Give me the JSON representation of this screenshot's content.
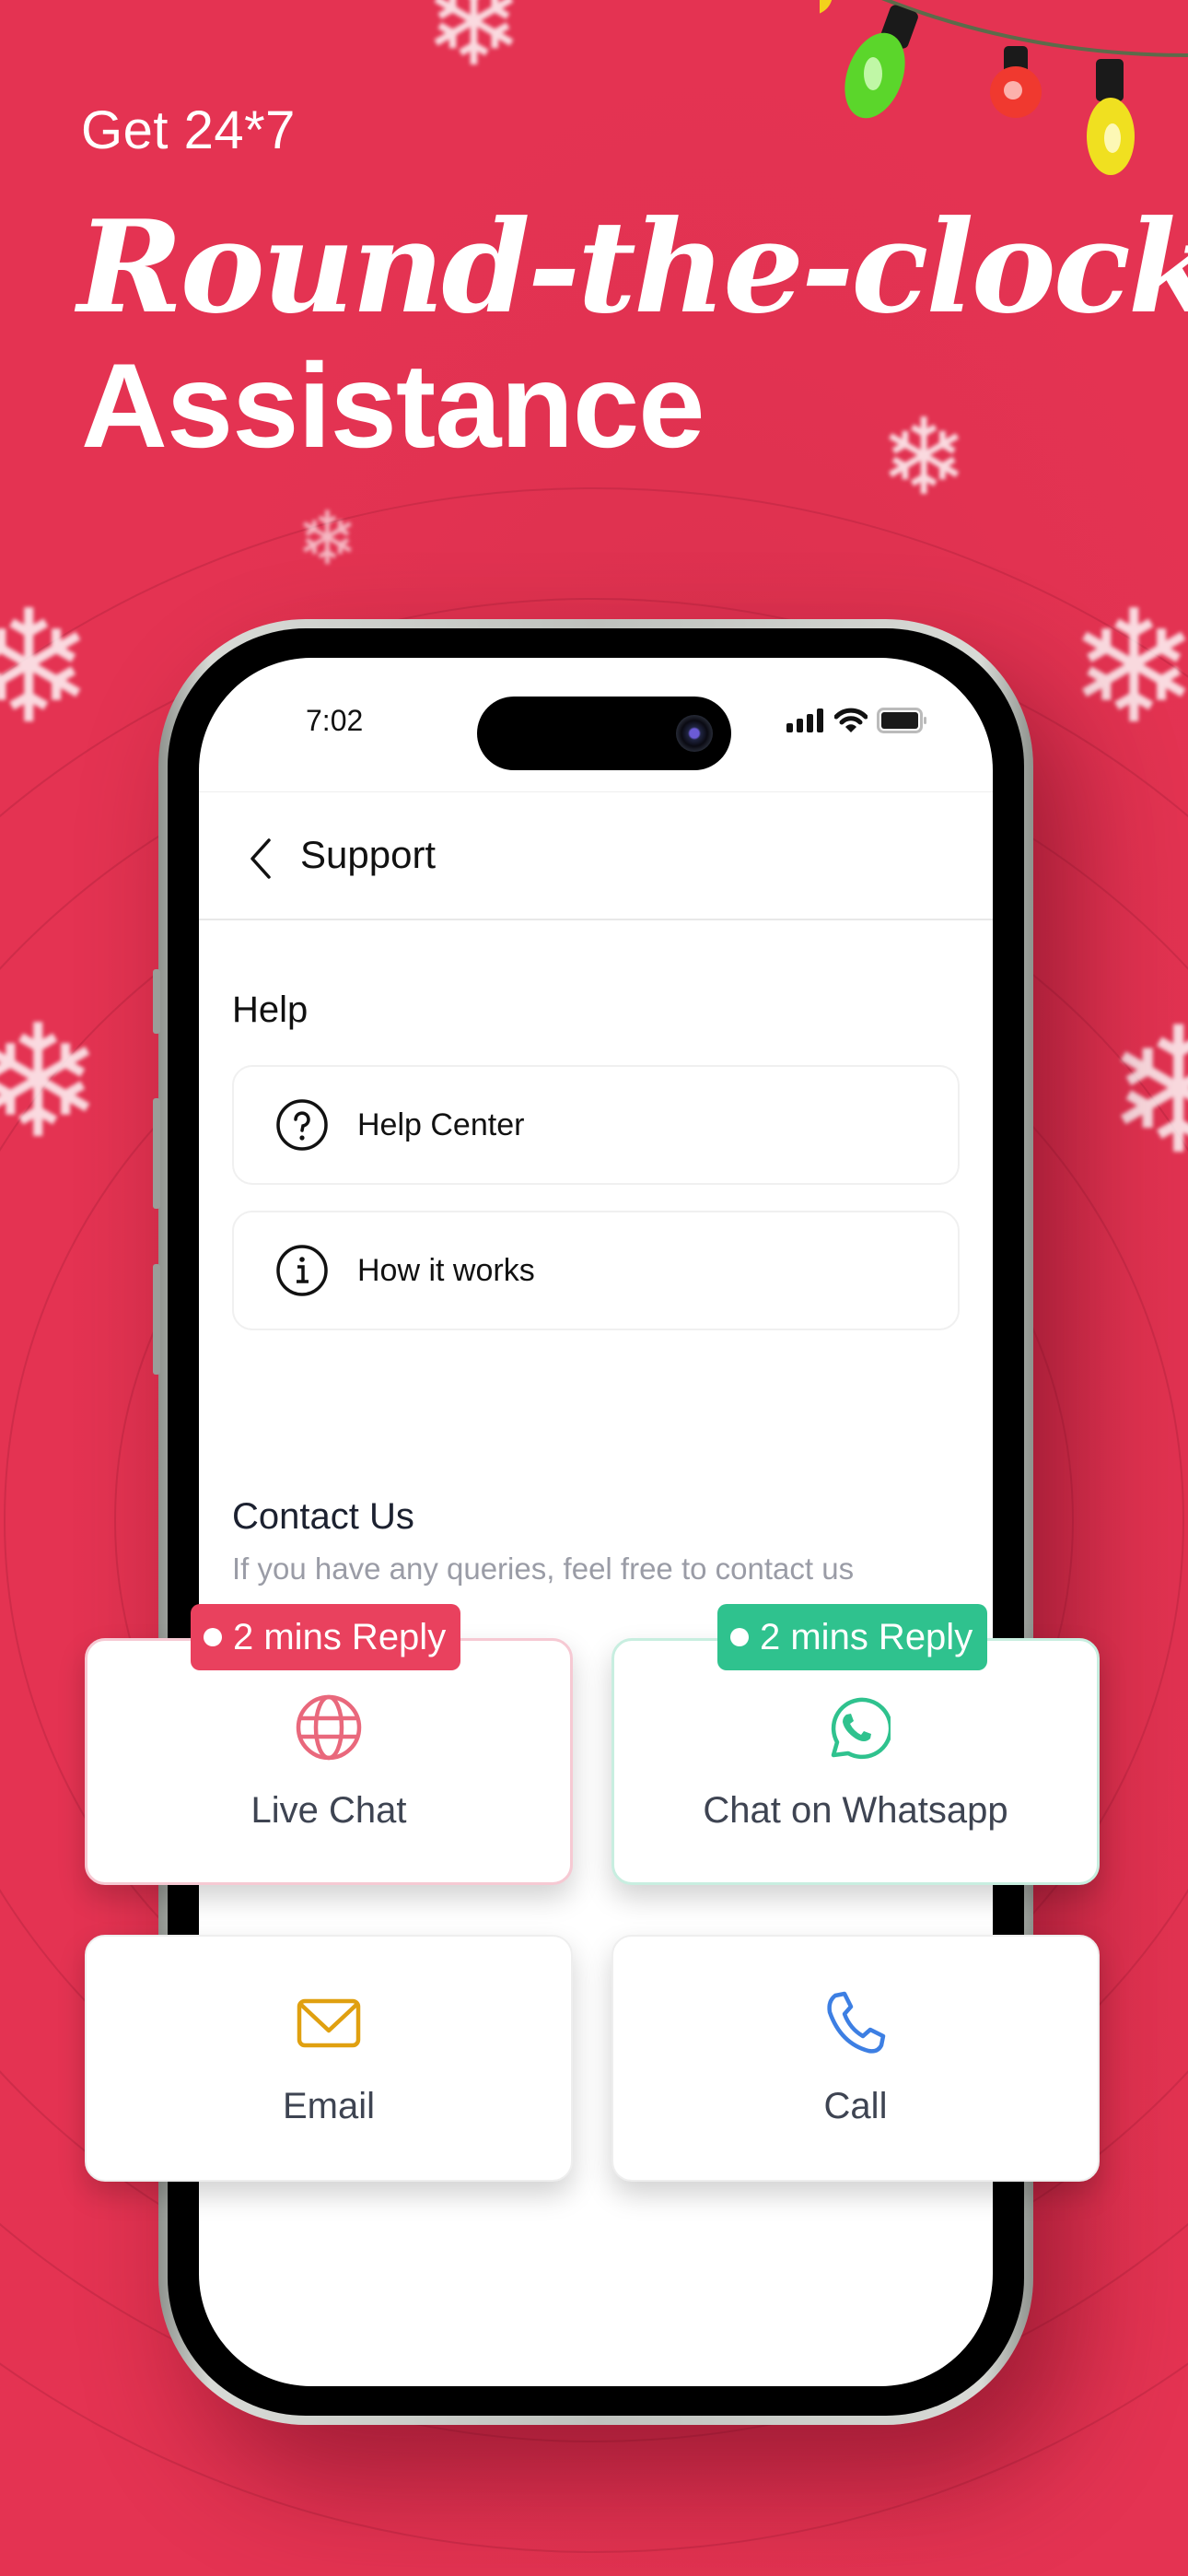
{
  "colors": {
    "background": "#e43352",
    "live_chat_accent": "#e9415e",
    "whatsapp_accent": "#2fc28e",
    "email_accent": "#e0a010",
    "call_accent": "#3d7fe3"
  },
  "hero": {
    "eyebrow": "Get 24*7",
    "headline_italic": "Round-the-clock",
    "headline_bold": "Assistance"
  },
  "status_bar": {
    "time": "7:02",
    "icons": [
      "cellular-signal-icon",
      "wifi-icon",
      "battery-icon"
    ]
  },
  "nav": {
    "back_icon": "chevron-left-icon",
    "title": "Support"
  },
  "help": {
    "title": "Help",
    "items": [
      {
        "icon": "question-circle-icon",
        "label": "Help Center"
      },
      {
        "icon": "info-circle-icon",
        "label": "How it works"
      }
    ]
  },
  "contact": {
    "title": "Contact Us",
    "subtitle": "If you have any queries, feel free to contact us",
    "options": [
      {
        "icon": "globe-icon",
        "label": "Live Chat",
        "badge": "2 mins Reply"
      },
      {
        "icon": "whatsapp-icon",
        "label": "Chat on Whatsapp",
        "badge": "2 mins Reply"
      },
      {
        "icon": "mail-icon",
        "label": "Email"
      },
      {
        "icon": "phone-icon",
        "label": "Call"
      }
    ]
  }
}
